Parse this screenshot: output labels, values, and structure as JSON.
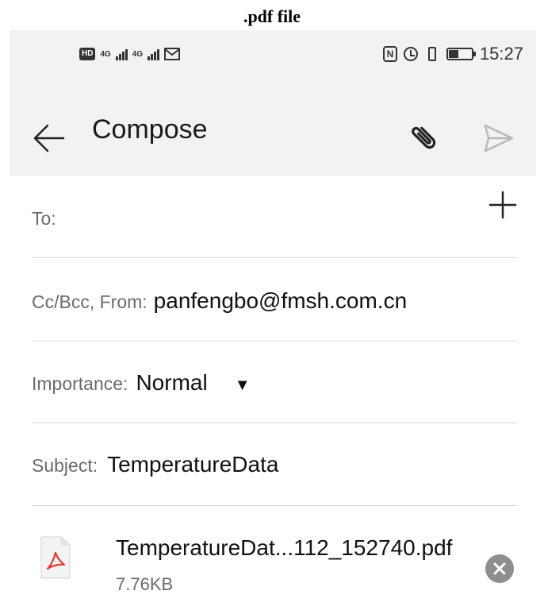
{
  "caption": ".pdf file",
  "status_bar": {
    "hd": "HD",
    "sim1": "4G",
    "sim2": "4G",
    "time": "15:27"
  },
  "app_bar": {
    "title": "Compose"
  },
  "fields": {
    "to_label": "To:",
    "ccbcc_label": "Cc/Bcc, From:",
    "from_value": "panfengbo@fmsh.com.cn",
    "importance_label": "Importance:",
    "importance_value": "Normal",
    "subject_label": "Subject:",
    "subject_value": "TemperatureData"
  },
  "attachment": {
    "name": "TemperatureDat...112_152740.pdf",
    "size": "7.76KB"
  },
  "colors": {
    "appbar_bg": "#f2f2f2",
    "divider": "#d8d8d8",
    "pdf_red": "#e53935",
    "send_disabled": "#b8b8b8"
  }
}
